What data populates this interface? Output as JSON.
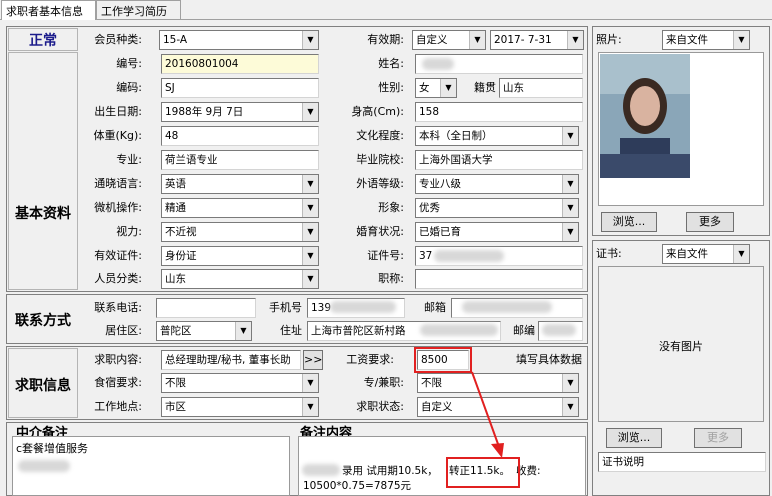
{
  "tabs": [
    "求职者基本信息",
    "工作学习简历"
  ],
  "status": "正常",
  "row_member": {
    "label": "会员种类:",
    "value": "15-A",
    "validity_label": "有效期:",
    "validity_mode": "自定义",
    "validity_date": "2017- 7-31"
  },
  "basic": {
    "section": "基本资料",
    "id_label": "编号:",
    "id_value": "20160801004",
    "name_label": "姓名:",
    "code_label": "编码:",
    "code_value": "SJ",
    "gender_label": "性别:",
    "gender_value": "女",
    "origin_label": "籍贯",
    "origin_value": "山东",
    "birth_label": "出生日期:",
    "birth_value": "1988年 9月 7日",
    "height_label": "身高(Cm):",
    "height_value": "158",
    "weight_label": "体重(Kg):",
    "weight_value": "48",
    "edu_label": "文化程度:",
    "edu_value": "本科（全日制）",
    "major_label": "专业:",
    "major_value": "荷兰语专业",
    "school_label": "毕业院校:",
    "school_value": "上海外国语大学",
    "lang_label": "通晓语言:",
    "lang_value": "英语",
    "langlevel_label": "外语等级:",
    "langlevel_value": "专业八级",
    "pc_label": "微机操作:",
    "pc_value": "精通",
    "image_label": "形象:",
    "image_value": "优秀",
    "vision_label": "视力:",
    "vision_value": "不近视",
    "marital_label": "婚育状况:",
    "marital_value": "已婚已育",
    "cert_label": "有效证件:",
    "cert_value": "身份证",
    "certno_label": "证件号:",
    "certno_value": "37",
    "category_label": "人员分类:",
    "category_value": "山东",
    "title_label": "职称:"
  },
  "contact": {
    "section": "联系方式",
    "phone_label": "联系电话:",
    "mobile_label": "手机号",
    "mobile_value": "139",
    "email_label": "邮箱",
    "district_label": "居住区:",
    "district_value": "普陀区",
    "address_label": "住址",
    "address_value": "上海市普陀区新村路",
    "zip_label": "邮编"
  },
  "job": {
    "section": "求职信息",
    "content_label": "求职内容:",
    "content_value": "总经理助理/秘书, 董事长助",
    "more_btn": ">>",
    "salary_label": "工资要求:",
    "salary_value": "8500",
    "salary_hint": "填写具体数据",
    "meal_label": "食宿要求:",
    "meal_value": "不限",
    "parttime_label": "专/兼职:",
    "parttime_value": "不限",
    "place_label": "工作地点:",
    "place_value": "市区",
    "jobstatus_label": "求职状态:",
    "jobstatus_value": "自定义"
  },
  "notes": {
    "agent_title": "中介备注",
    "agent_text": "c套餐增值服务",
    "remark_title": "备注内容",
    "remark_line1a": "录用 试用期10.5k，",
    "remark_highlight": "转正11.5k。",
    "remark_line1b": "收费:",
    "remark_line2": "10500*0.75=7875元"
  },
  "photo": {
    "label": "照片:",
    "source": "来自文件",
    "browse": "浏览...",
    "more": "更多"
  },
  "certificate": {
    "label": "证书:",
    "source": "来自文件",
    "no_image": "没有图片",
    "browse": "浏览...",
    "more": "更多",
    "desc": "证书说明"
  },
  "colors": {
    "highlight_red": "#e12020",
    "title_blue": "#1c1c8c"
  }
}
